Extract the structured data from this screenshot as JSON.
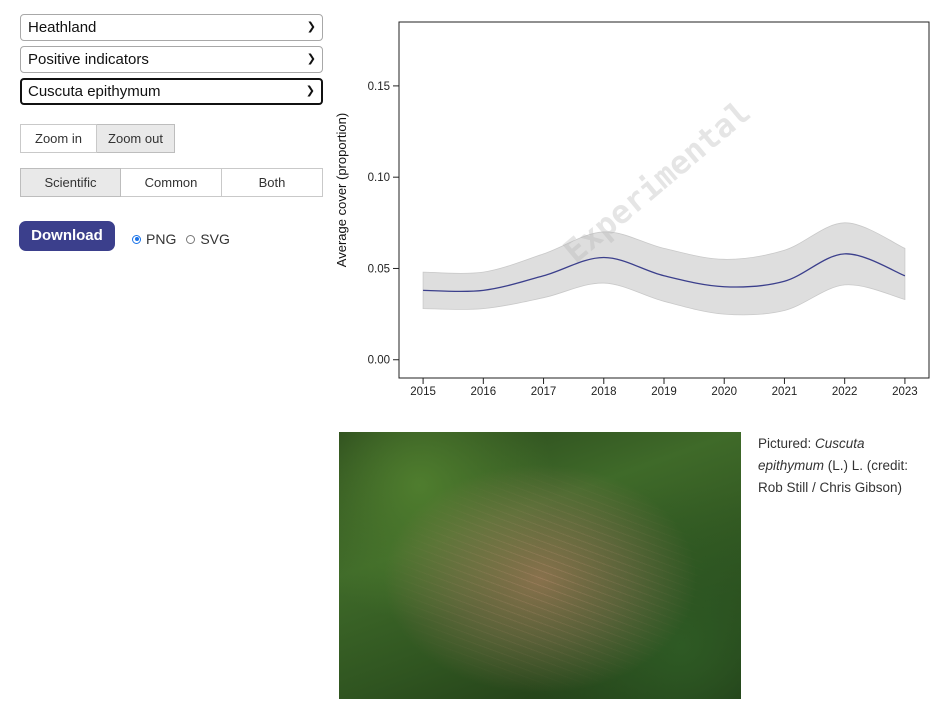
{
  "controls": {
    "habitat_select": "Heathland",
    "indicator_select": "Positive indicators",
    "species_select": "Cuscuta epithymum",
    "zoom_in_label": "Zoom in",
    "zoom_out_label": "Zoom out",
    "zoom_active": "Zoom out",
    "name_scientific_label": "Scientific",
    "name_common_label": "Common",
    "name_both_label": "Both",
    "name_active": "Scientific",
    "download_label": "Download",
    "format_png_label": "PNG",
    "format_svg_label": "SVG",
    "format_selected": "PNG",
    "chevron_icon": "chevron-down-icon"
  },
  "chart_data": {
    "type": "line",
    "title": "",
    "xlabel": "",
    "ylabel": "Average cover (proportion)",
    "watermark": "Experimental",
    "x": [
      2015,
      2016,
      2017,
      2018,
      2019,
      2020,
      2021,
      2022,
      2023
    ],
    "xticks": [
      "2015",
      "2016",
      "2017",
      "2018",
      "2019",
      "2020",
      "2021",
      "2022",
      "2023"
    ],
    "yticks": [
      "0.00",
      "0.05",
      "0.10",
      "0.15"
    ],
    "ylim": [
      -0.01,
      0.185
    ],
    "xlim": [
      2014.6,
      2023.4
    ],
    "series": [
      {
        "values": [
          0.038,
          0.038,
          0.046,
          0.056,
          0.046,
          0.04,
          0.043,
          0.058,
          0.046
        ],
        "lower": [
          0.028,
          0.028,
          0.034,
          0.042,
          0.032,
          0.025,
          0.027,
          0.041,
          0.033
        ],
        "upper": [
          0.048,
          0.048,
          0.058,
          0.07,
          0.061,
          0.055,
          0.06,
          0.075,
          0.061
        ],
        "color": "#3b3f8c",
        "band_color": "#dedede"
      }
    ],
    "grid": false
  },
  "photo": {
    "caption_prefix": "Pictured: ",
    "caption_species": "Cuscuta epithymum",
    "caption_suffix": " (L.) L. (credit: Rob Still / Chris Gibson)"
  }
}
